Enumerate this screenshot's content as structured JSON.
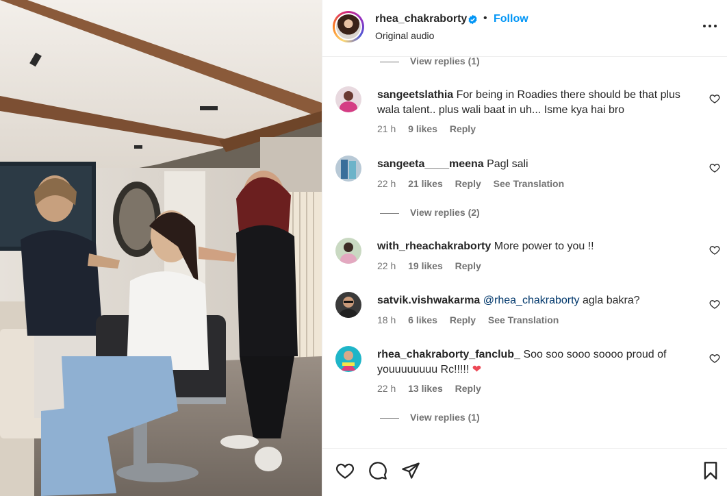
{
  "header": {
    "username": "rhea_chakraborty",
    "separator": "•",
    "follow_label": "Follow",
    "subtitle": "Original audio",
    "verified_icon": "verified-badge-icon",
    "more_icon": "more-options-icon"
  },
  "comments": {
    "top_view_replies": "View replies (1)",
    "items": [
      {
        "username": "sangeetslathia",
        "text": "For being in Roadies there should be that plus wala talent.. plus wali baat in uh... Isme kya hai bro",
        "time": "21 h",
        "likes": "9 likes",
        "reply": "Reply"
      },
      {
        "username": "sangeeta____meena",
        "text": "Pagl sali",
        "time": "22 h",
        "likes": "21 likes",
        "reply": "Reply",
        "translation": "See Translation",
        "view_replies": "View replies (2)"
      },
      {
        "username": "with_rheachakraborty",
        "text": "More power to you !!",
        "time": "22 h",
        "likes": "19 likes",
        "reply": "Reply"
      },
      {
        "username": "satvik.vishwakarma",
        "mention": "@rhea_chakraborty",
        "text": "agla bakra?",
        "time": "18 h",
        "likes": "6 likes",
        "reply": "Reply",
        "translation": "See Translation"
      },
      {
        "username": "rhea_chakraborty_fanclub_",
        "text": "Soo soo sooo soooo proud of youuuuuuuu Rc!!!!!",
        "emoji": "❤",
        "time": "22 h",
        "likes": "13 likes",
        "reply": "Reply",
        "view_replies": "View replies (1)"
      }
    ]
  },
  "actions": {
    "like_icon": "heart-icon",
    "comment_icon": "comment-icon",
    "share_icon": "share-icon",
    "save_icon": "bookmark-icon"
  },
  "colors": {
    "follow_blue": "#0095f6",
    "mention_blue": "#00376b",
    "secondary_text": "#737373",
    "heart_red": "#ed4956"
  }
}
